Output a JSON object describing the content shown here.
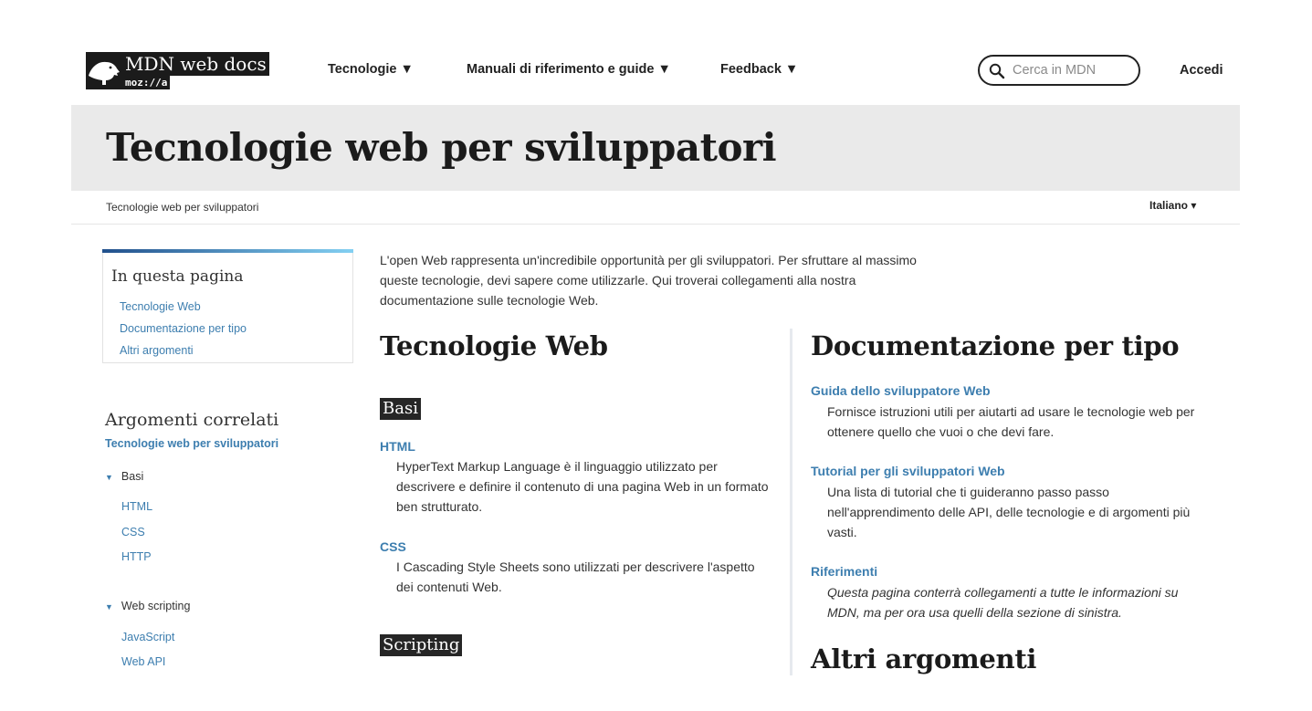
{
  "header": {
    "logo": {
      "title": "MDN web docs",
      "sub": "moz://a"
    },
    "nav": [
      {
        "label": "Tecnologie ▼"
      },
      {
        "label": "Manuali di riferimento e guide ▼"
      },
      {
        "label": "Feedback ▼"
      }
    ],
    "search": {
      "placeholder": "Cerca in MDN"
    },
    "login": "Accedi"
  },
  "page": {
    "title": "Tecnologie web per sviluppatori",
    "breadcrumb": "Tecnologie web per sviluppatori",
    "language": "Italiano ▾"
  },
  "sidebar": {
    "toc": {
      "heading": "In questa pagina",
      "links": [
        "Tecnologie Web",
        "Documentazione per tipo",
        "Altri argomenti"
      ]
    },
    "related": {
      "heading": "Argomenti correlati",
      "subheading": "Tecnologie web per sviluppatori",
      "groups": [
        {
          "label": "Basi",
          "items": [
            "HTML",
            "CSS",
            "HTTP"
          ]
        },
        {
          "label": "Web scripting",
          "items": [
            "JavaScript",
            "Web API"
          ]
        }
      ]
    }
  },
  "main": {
    "intro": "L'open Web rappresenta un'incredibile opportunità per gli sviluppatori. Per sfruttare al massimo queste tecnologie, devi sapere come utilizzarle. Qui troverai collegamenti alla nostra documentazione sulle tecnologie Web.",
    "left": {
      "heading": "Tecnologie Web",
      "sections": [
        {
          "tag": "Basi",
          "entries": [
            {
              "term": "HTML",
              "desc": "HyperText Markup Language è il linguaggio utilizzato per descrivere e definire il contenuto di una pagina Web in un formato ben strutturato."
            },
            {
              "term": "CSS",
              "desc": "I Cascading Style Sheets sono utilizzati per descrivere l'aspetto dei contenuti Web."
            }
          ]
        },
        {
          "tag": "Scripting"
        }
      ]
    },
    "right": {
      "heading": "Documentazione per tipo",
      "entries": [
        {
          "term": "Guida dello sviluppatore Web",
          "desc": "Fornisce istruzioni utili per aiutarti ad usare le tecnologie web per ottenere quello che vuoi o che devi fare."
        },
        {
          "term": "Tutorial per gli sviluppatori Web",
          "desc": "Una lista di tutorial che ti guideranno passo passo nell'apprendimento delle API, delle tecnologie e di argomenti più vasti."
        },
        {
          "term": "Riferimenti",
          "desc": "Questa pagina conterrà collegamenti a tutte le informazioni su MDN, ma per ora usa quelli della sezione di sinistra."
        }
      ],
      "heading2": "Altri argomenti"
    }
  }
}
